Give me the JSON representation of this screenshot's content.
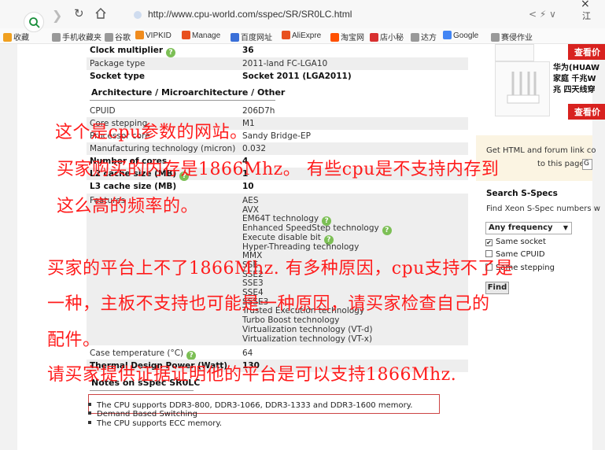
{
  "browser": {
    "url": "http://www.cpu-world.com/sspec/SR/SR0LC.html",
    "extension_label": "江",
    "close_glyph": "×",
    "bookmarks": [
      {
        "label": "收藏",
        "color": "#f0a020"
      },
      {
        "label": "手机收藏夹",
        "color": "#999999"
      },
      {
        "label": "谷歌",
        "color": "#999999"
      },
      {
        "label": "VIPKID",
        "color": "#f08c1e"
      },
      {
        "label": "Manage",
        "color": "#e8501e"
      },
      {
        "label": "百度网址",
        "color": "#3a6fd8"
      },
      {
        "label": "AliExpre",
        "color": "#e8501e"
      },
      {
        "label": "淘宝网",
        "color": "#ff5000"
      },
      {
        "label": "店小秘",
        "color": "#d83030"
      },
      {
        "label": "达方",
        "color": "#999999"
      },
      {
        "label": "Google",
        "color": "#4285f4"
      },
      {
        "label": "赛侵作业",
        "color": "#999999"
      }
    ]
  },
  "spec_rows": [
    {
      "label": "Clock multiplier",
      "value": "36",
      "bold": true,
      "help": true
    },
    {
      "label": "Package type",
      "value": "2011-land FC-LGA10",
      "bold": false,
      "help": false
    },
    {
      "label": "Socket type",
      "value": "Socket 2011 (LGA2011)",
      "bold": true,
      "help": false
    }
  ],
  "section_arch": "Architecture / Microarchitecture / Other",
  "arch_rows": [
    {
      "label": "CPUID",
      "value": "206D7h"
    },
    {
      "label": "Core stepping",
      "value": "M1"
    },
    {
      "label": "Processor core",
      "value": "Sandy Bridge-EP"
    },
    {
      "label": "Manufacturing technology (micron)",
      "value": "0.032"
    },
    {
      "label": "Number of cores",
      "value": "4"
    },
    {
      "label": "L2 cache size (MB)",
      "value": "1"
    },
    {
      "label": "L3 cache size (MB)",
      "value": "10"
    }
  ],
  "features_label": "Features",
  "features": [
    "AES",
    "AVX",
    "EM64T technology",
    "Enhanced SpeedStep technology",
    "Execute disable bit",
    "Hyper-Threading technology",
    "MMX",
    "SSE",
    "SSE2",
    "SSE3",
    "SSE4",
    "SSSE3",
    "Trusted Execution technology",
    "Turbo Boost technology",
    "Virtualization technology (VT-d)",
    "Virtualization technology (VT-x)"
  ],
  "extra_rows": [
    {
      "label": "Case temperature (°C)",
      "value": "64"
    },
    {
      "label": "Thermal Design Power (Watt)",
      "value": "130"
    }
  ],
  "section_notes": "Notes on sSpec SR0LC",
  "notes": [
    "The CPU supports DDR3-800, DDR3-1066, DDR3-1333 and DDR3-1600 memory.",
    "Demand Based Switching",
    "The CPU supports ECC memory."
  ],
  "sidebar": {
    "ad_button_1": "查看价",
    "ad_text": [
      "华为(HUAW",
      "家庭 千兆W",
      "兆 四天线穿"
    ],
    "ad_button_2": "查看价",
    "get_html_1": "Get HTML and forum link co",
    "get_html_2": "to this page:",
    "get_html_input": "G",
    "search_title": "Search S-Specs",
    "search_desc": "Find Xeon S-Spec numbers w",
    "select_value": "Any frequency",
    "checkboxes": [
      {
        "label": "Same socket",
        "checked": true
      },
      {
        "label": "Same CPUID",
        "checked": false
      },
      {
        "label": "Same stepping",
        "checked": false
      }
    ],
    "find_button": "Find"
  },
  "overlay_text": [
    "这个是cpu参数的网站。",
    "买家购买的内存是1866Mhz。 有些cpu是不支持内存到",
    "这么高的频率的。",
    "买家的平台上不了1866Mhz. 有多种原因，cpu支持不了是",
    "一种，主板不支持也可能是一种原因，请买家检查自己的",
    "配件。",
    "请买家提供证据证明他的平台是可以支持1866Mhz."
  ]
}
